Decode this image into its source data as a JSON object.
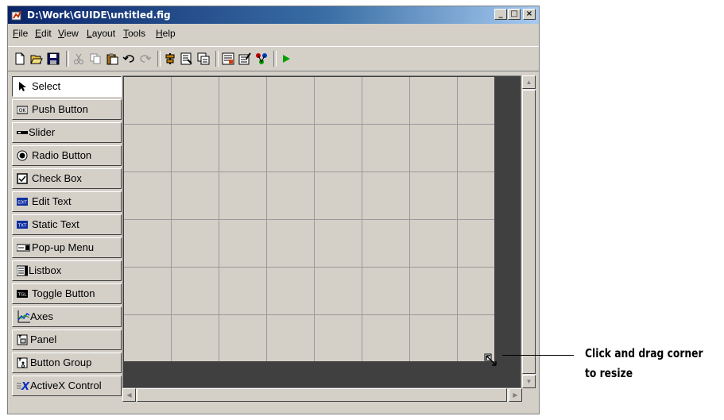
{
  "window": {
    "title": "D:\\Work\\GUIDE\\untitled.fig",
    "controls": [
      "_",
      "□",
      "×"
    ]
  },
  "menu": [
    "File",
    "Edit",
    "View",
    "Layout",
    "Tools",
    "Help"
  ],
  "toolbar": [
    "new-icon",
    "open-icon",
    "save-icon",
    "cut-icon",
    "copy-icon",
    "paste-icon",
    "undo-icon",
    "redo-icon",
    "align-icon",
    "menu-editor-icon",
    "tab-order-icon",
    "mfile-editor-icon",
    "property-inspector-icon",
    "object-browser-icon",
    "run-icon"
  ],
  "palette": [
    {
      "label": "Select",
      "icon": "arrow-icon"
    },
    {
      "label": "Push Button",
      "icon": "push-button-icon"
    },
    {
      "label": "Slider",
      "icon": "slider-icon"
    },
    {
      "label": "Radio Button",
      "icon": "radio-icon"
    },
    {
      "label": "Check Box",
      "icon": "checkbox-icon"
    },
    {
      "label": "Edit Text",
      "icon": "edit-text-icon"
    },
    {
      "label": "Static Text",
      "icon": "static-text-icon"
    },
    {
      "label": "Pop-up Menu",
      "icon": "popup-icon"
    },
    {
      "label": "Listbox",
      "icon": "listbox-icon"
    },
    {
      "label": "Toggle Button",
      "icon": "toggle-icon"
    },
    {
      "label": "Axes",
      "icon": "axes-icon"
    },
    {
      "label": "Panel",
      "icon": "panel-icon"
    },
    {
      "label": "Button Group",
      "icon": "button-group-icon"
    },
    {
      "label": "ActiveX Control",
      "icon": "activex-icon"
    }
  ],
  "icon_text": {
    "push": "OK",
    "edit": "EDIT",
    "static": "TXT",
    "toggle": "TGL",
    "activex": "X"
  },
  "callout": {
    "line1": "Click and drag corner",
    "line2": "to resize"
  },
  "colors": {
    "title_start": "#0a246a",
    "title_end": "#a6caf0",
    "chrome": "#d4d0c8",
    "canvas_bg": "#404040",
    "run_green": "#00a000"
  }
}
